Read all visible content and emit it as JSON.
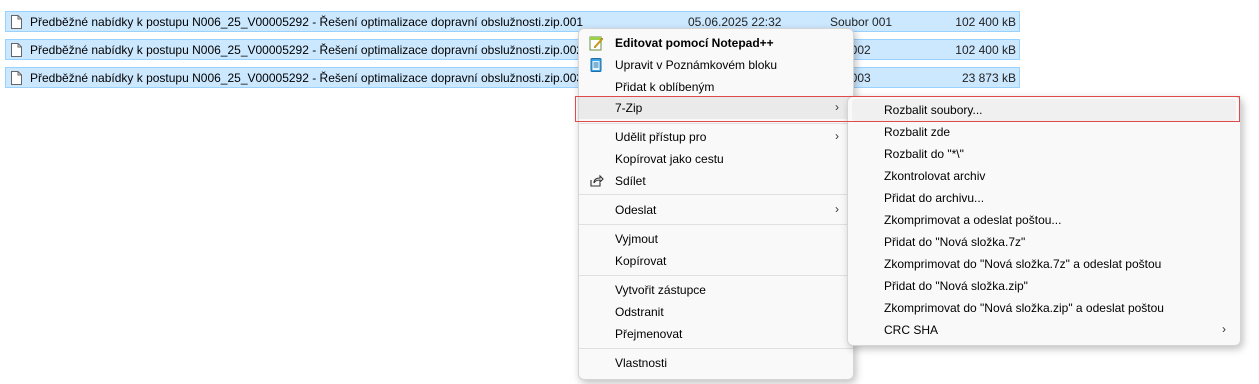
{
  "files": [
    {
      "name": "Předběžné nabídky k postupu N006_25_V00005292 - Řešení optimalizace dopravní obslužnosti.zip.001",
      "date": "05.06.2025 22:32",
      "type": "Soubor 001",
      "size": "102 400 kB"
    },
    {
      "name": "Předběžné nabídky k postupu N006_25_V00005292 - Řešení optimalizace dopravní obslužnosti.zip.002",
      "date": "",
      "type": "bor 002",
      "size": "102 400 kB"
    },
    {
      "name": "Předběžné nabídky k postupu N006_25_V00005292 - Řešení optimalizace dopravní obslužnosti.zip.003",
      "date": "",
      "type": "bor 003",
      "size": "23 873 kB"
    }
  ],
  "context_menu": {
    "edit_notepadpp": "Editovat pomocí Notepad++",
    "edit_notepad": "Upravit v Poznámkovém bloku",
    "add_favorites": "Přidat k oblíbeným",
    "seven_zip": "7-Zip",
    "grant_access": "Udělit přístup pro",
    "copy_as_path": "Kopírovat jako cestu",
    "share": "Sdílet",
    "send_to": "Odeslat",
    "cut": "Vyjmout",
    "copy": "Kopírovat",
    "create_shortcut": "Vytvořit zástupce",
    "delete": "Odstranit",
    "rename": "Přejmenovat",
    "properties": "Vlastnosti"
  },
  "zip_submenu": {
    "items": [
      "Rozbalit soubory...",
      "Rozbalit zde",
      "Rozbalit do \"*\\\"",
      "Zkontrolovat archiv",
      "Přidat do archivu...",
      "Zkomprimovat a odeslat poštou...",
      "Přidat do \"Nová složka.7z\"",
      "Zkomprimovat do \"Nová složka.7z\" a odeslat poštou",
      "Přidat do \"Nová složka.zip\"",
      "Zkomprimovat do \"Nová složka.zip\" a odeslat poštou",
      "CRC SHA"
    ]
  },
  "icons": {
    "file": "file-icon",
    "notepadpp": "notepadpp-icon",
    "notepad": "notepad-icon",
    "share": "share-icon",
    "submenu_arrow": "chevron-right-icon"
  },
  "colors": {
    "selection_bg": "#cce8ff",
    "selection_border": "#99d1ff",
    "highlight_outline": "#e04a4a",
    "menu_bg": "#f9f9f9"
  }
}
